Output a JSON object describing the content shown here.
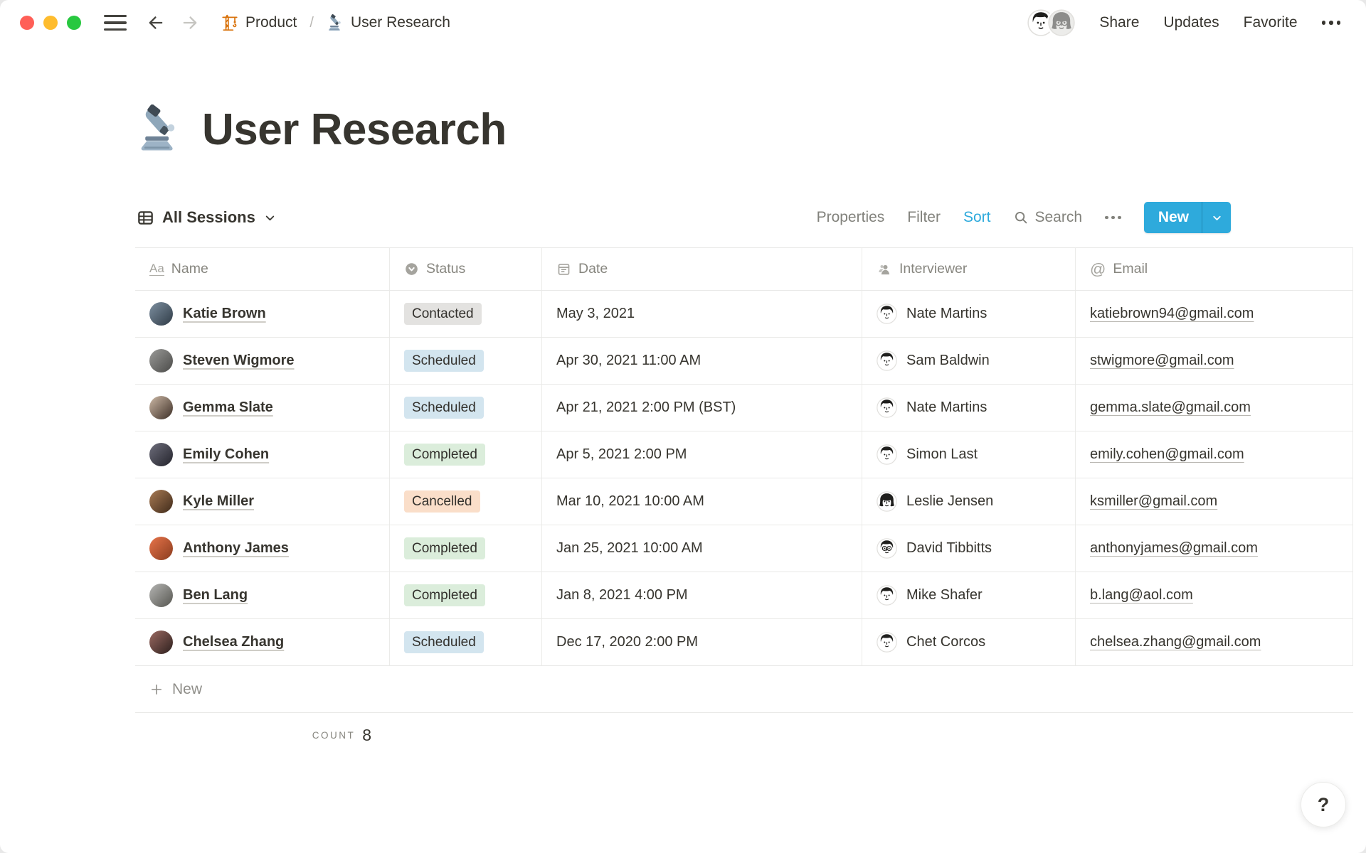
{
  "window": {
    "traffic_lights": [
      "#FF5F57",
      "#FEBC2E",
      "#28C840"
    ],
    "breadcrumb": {
      "items": [
        {
          "label": "Product",
          "icon": "crane-icon"
        },
        {
          "label": "User Research",
          "icon": "microscope-icon"
        }
      ],
      "separator": "/"
    },
    "actions": {
      "share": "Share",
      "updates": "Updates",
      "favorite": "Favorite"
    }
  },
  "page": {
    "title": "User Research",
    "icon": "microscope-icon"
  },
  "view_bar": {
    "view_name": "All Sessions",
    "properties_label": "Properties",
    "filter_label": "Filter",
    "sort_label": "Sort",
    "search_label": "Search",
    "new_label": "New"
  },
  "table": {
    "columns": [
      {
        "label": "Name",
        "icon": "text-property-icon"
      },
      {
        "label": "Status",
        "icon": "select-property-icon"
      },
      {
        "label": "Date",
        "icon": "calendar-property-icon"
      },
      {
        "label": "Interviewer",
        "icon": "person-property-icon"
      },
      {
        "label": "Email",
        "icon": "at-property-icon"
      }
    ],
    "status_colors": {
      "Contacted": "#E3E2E0",
      "Scheduled": "#D3E5EF",
      "Completed": "#DBEDDB",
      "Cancelled": "#FADEC9"
    },
    "rows": [
      {
        "name": "Katie Brown",
        "status": "Contacted",
        "date": "May 3, 2021",
        "interviewer": "Nate Martins",
        "email": "katiebrown94@gmail.com",
        "avatar_colors": [
          "#7d8fa0",
          "#2f3b46"
        ],
        "interviewer_style": "short"
      },
      {
        "name": "Steven Wigmore",
        "status": "Scheduled",
        "date": "Apr 30, 2021 11:00 AM",
        "interviewer": "Sam Baldwin",
        "email": "stwigmore@gmail.com",
        "avatar_colors": [
          "#9a9a98",
          "#4a4a48"
        ],
        "interviewer_style": "short"
      },
      {
        "name": "Gemma Slate",
        "status": "Scheduled",
        "date": "Apr 21, 2021 2:00 PM (BST)",
        "interviewer": "Nate Martins",
        "email": "gemma.slate@gmail.com",
        "avatar_colors": [
          "#cdb9a6",
          "#3c2e26"
        ],
        "interviewer_style": "short"
      },
      {
        "name": "Emily Cohen",
        "status": "Completed",
        "date": "Apr 5, 2021 2:00 PM",
        "interviewer": "Simon Last",
        "email": "emily.cohen@gmail.com",
        "avatar_colors": [
          "#6e6e7c",
          "#23232b"
        ],
        "interviewer_style": "short"
      },
      {
        "name": "Kyle Miller",
        "status": "Cancelled",
        "date": "Mar 10, 2021 10:00 AM",
        "interviewer": "Leslie Jensen",
        "email": "ksmiller@gmail.com",
        "avatar_colors": [
          "#a97b54",
          "#3f2a1a"
        ],
        "interviewer_style": "long"
      },
      {
        "name": "Anthony James",
        "status": "Completed",
        "date": "Jan 25, 2021 10:00 AM",
        "interviewer": "David Tibbitts",
        "email": "anthonyjames@gmail.com",
        "avatar_colors": [
          "#e8744a",
          "#8a3c1e"
        ],
        "interviewer_style": "short glasses"
      },
      {
        "name": "Ben Lang",
        "status": "Completed",
        "date": "Jan 8, 2021 4:00 PM",
        "interviewer": "Mike Shafer",
        "email": "b.lang@aol.com",
        "avatar_colors": [
          "#b5b5b3",
          "#565650"
        ],
        "interviewer_style": "short"
      },
      {
        "name": "Chelsea Zhang",
        "status": "Scheduled",
        "date": "Dec 17, 2020 2:00 PM",
        "interviewer": "Chet Corcos",
        "email": "chelsea.zhang@gmail.com",
        "avatar_colors": [
          "#9c6a62",
          "#2c1f1d"
        ],
        "interviewer_style": "short"
      }
    ],
    "new_row_label": "New",
    "count_label": "COUNT",
    "count_value": "8"
  },
  "help": {
    "label": "?"
  },
  "colors": {
    "accent": "#2EAADC"
  }
}
